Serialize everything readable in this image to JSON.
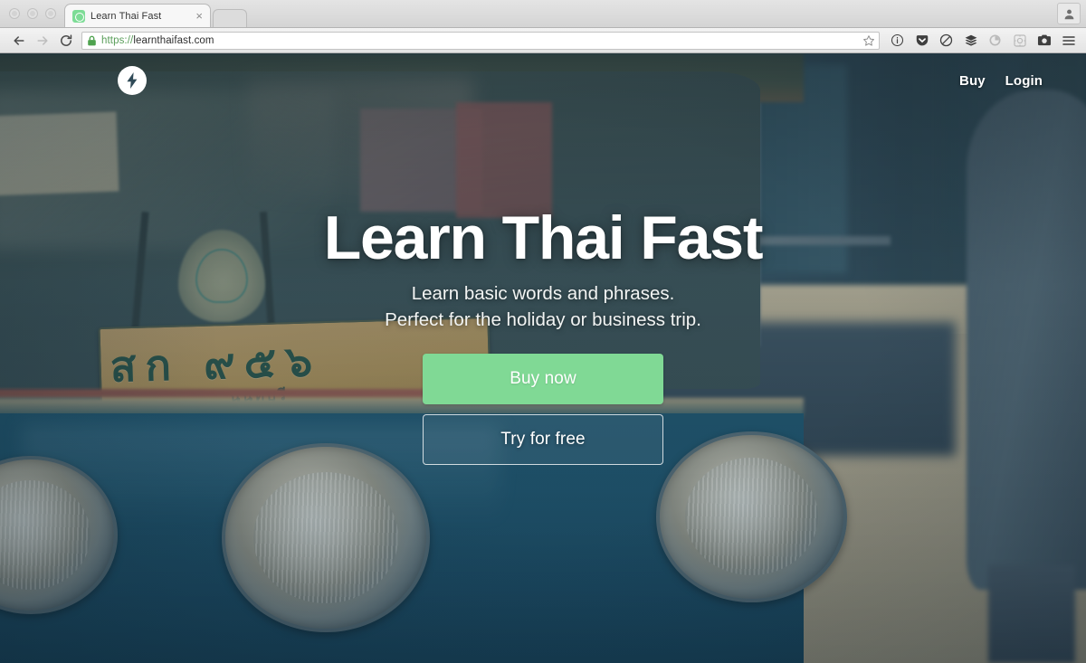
{
  "browser": {
    "window_controls": [
      "close",
      "minimize",
      "maximize"
    ],
    "tab": {
      "title": "Learn Thai Fast",
      "close_label": "×",
      "favicon_name": "circle-target-favicon"
    },
    "new_tab_label": "+",
    "profile_icon": "user-avatar-icon",
    "nav": {
      "back_label": "Back",
      "forward_label": "Forward",
      "reload_label": "Reload"
    },
    "url": {
      "scheme": "https://",
      "host": "learnthaifast.com",
      "full": "https://learnthaifast.com",
      "secure": true,
      "lock_icon": "green-padlock-icon",
      "bookmark_icon": "star-icon"
    },
    "extensions": [
      {
        "name": "info-circle-icon",
        "faded": false
      },
      {
        "name": "pocket-icon",
        "faded": false
      },
      {
        "name": "adblock-icon",
        "faded": false
      },
      {
        "name": "layers-stack-icon",
        "faded": false
      },
      {
        "name": "sync-circle-icon",
        "faded": true
      },
      {
        "name": "qr-square-icon",
        "faded": true
      },
      {
        "name": "camera-icon",
        "faded": false
      },
      {
        "name": "hamburger-menu-icon",
        "faded": false
      }
    ]
  },
  "page": {
    "logo_name": "lightning-bolt-logo",
    "nav_links": [
      {
        "label": "Buy",
        "name": "nav-link-buy"
      },
      {
        "label": "Login",
        "name": "nav-link-login"
      }
    ],
    "hero": {
      "title": "Learn Thai Fast",
      "subtitle_line1": "Learn basic words and phrases.",
      "subtitle_line2": "Perfect for the holiday or business trip.",
      "primary_cta": "Buy now",
      "secondary_cta": "Try for free"
    },
    "background": {
      "description": "thai-tuk-tuk-photo",
      "license_plate_top": "สก  ๙๕๖",
      "license_plate_bottom": "นนทบุรี"
    },
    "colors": {
      "primary_button": "#80d995",
      "text_on_hero": "#ffffff",
      "hero_tint": "#27485c",
      "favicon_green": "#7ddc96",
      "url_scheme_green": "#5a9e5a"
    }
  }
}
